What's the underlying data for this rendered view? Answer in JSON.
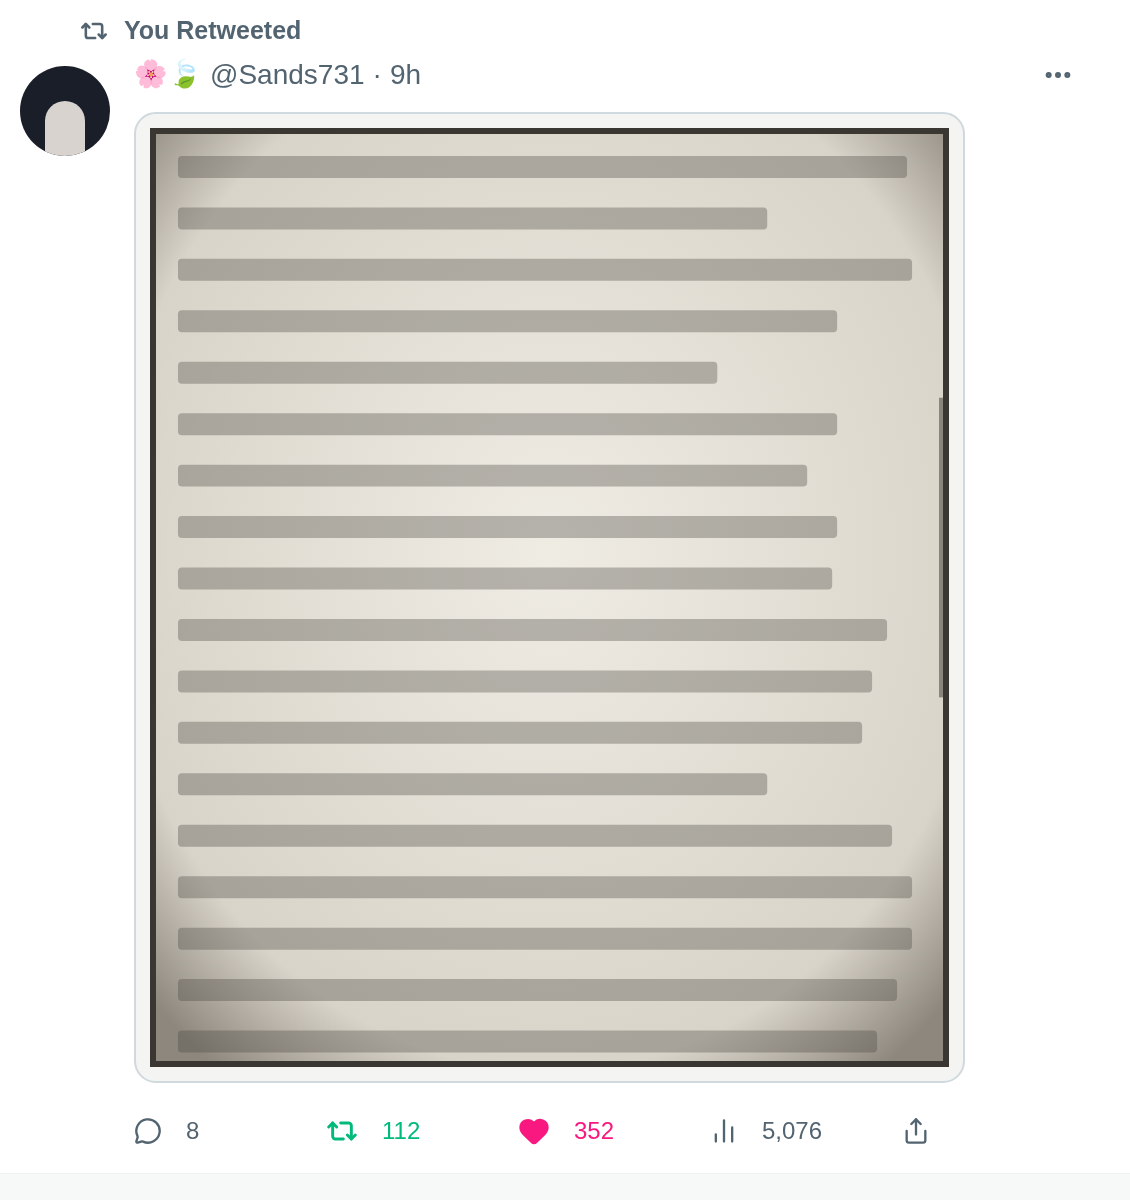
{
  "social_context": "You Retweeted",
  "author": {
    "name_emoji": "🌸🍃",
    "handle": "@Sands731",
    "separator": "·",
    "time": "9h"
  },
  "actions": [
    {
      "kind": "reply",
      "count": "8"
    },
    {
      "kind": "retweet",
      "count": "112",
      "selected": true
    },
    {
      "kind": "like",
      "count": "352",
      "selected": true
    },
    {
      "kind": "views",
      "count": "5,076"
    },
    {
      "kind": "share"
    }
  ]
}
